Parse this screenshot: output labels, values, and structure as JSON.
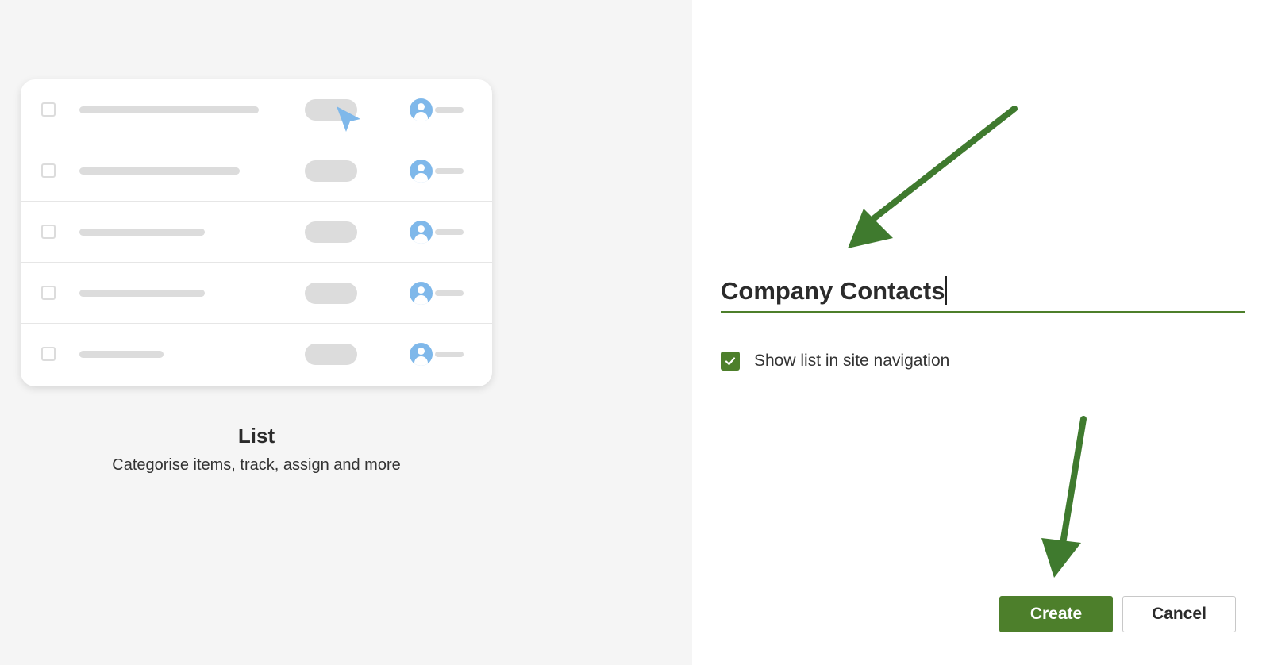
{
  "template_preview": {
    "title": "List",
    "description": "Categorise items, track, assign and more",
    "accent_color": "#7fb8ea"
  },
  "form": {
    "list_name_value": "Company Contacts",
    "show_in_navigation": {
      "label": "Show list in site navigation",
      "checked": true
    },
    "create_label": "Create",
    "cancel_label": "Cancel",
    "accent_color": "#4d7f2b"
  },
  "annotations": {
    "arrow_color": "#3f7a2e",
    "arrows": [
      "arrow-to-name-field",
      "arrow-to-create-button"
    ]
  }
}
